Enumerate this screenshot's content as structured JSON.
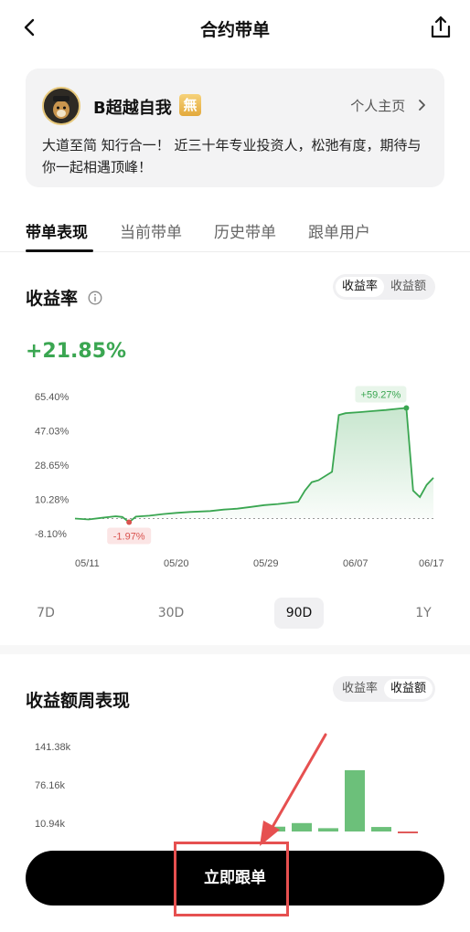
{
  "header": {
    "title": "合约带单",
    "back_icon": "chevron-left-icon",
    "share_icon": "share-icon"
  },
  "profile": {
    "name": "B超越自我",
    "badge": "無",
    "homepage_link": "个人主页",
    "bio": "大道至简 知行合一！ 近三十年专业投资人，松弛有度，期待与你一起相遇顶峰！"
  },
  "tabs": [
    {
      "label": "带单表现",
      "active": true
    },
    {
      "label": "当前带单",
      "active": false
    },
    {
      "label": "历史带单",
      "active": false
    },
    {
      "label": "跟单用户",
      "active": false
    }
  ],
  "returns": {
    "title": "收益率",
    "toggle": [
      "收益率",
      "收益额"
    ],
    "toggle_active": 0,
    "value": "+21.85%",
    "value_color": "#3aa651",
    "periods": [
      "7D",
      "30D",
      "90D",
      "1Y"
    ],
    "period_active": 2
  },
  "chart_data": [
    {
      "type": "area",
      "y_ticks": [
        "65.40%",
        "47.03%",
        "28.65%",
        "10.28%",
        "-8.10%"
      ],
      "x_ticks": [
        "05/11",
        "05/20",
        "05/29",
        "06/07",
        "06/17"
      ],
      "ylim": [
        -8.1,
        65.4
      ],
      "annotations": [
        {
          "label": "+59.27%",
          "color": "#3aa651"
        },
        {
          "label": "-1.97%",
          "color": "#d9534f"
        }
      ],
      "series": [
        {
          "color": "#3aa651",
          "points": [
            [
              0,
              0.0
            ],
            [
              2,
              -0.5
            ],
            [
              4,
              0.4
            ],
            [
              6,
              1.2
            ],
            [
              7,
              0.8
            ],
            [
              8,
              -1.97
            ],
            [
              9,
              1.0
            ],
            [
              11,
              1.5
            ],
            [
              13,
              2.4
            ],
            [
              15,
              3.0
            ],
            [
              17,
              3.5
            ],
            [
              20,
              4.0
            ],
            [
              22,
              4.8
            ],
            [
              24,
              5.3
            ],
            [
              26,
              6.2
            ],
            [
              28,
              7.2
            ],
            [
              30,
              7.8
            ],
            [
              33,
              9.0
            ],
            [
              34,
              15.0
            ],
            [
              35,
              19.5
            ],
            [
              36,
              20.5
            ],
            [
              38,
              25.0
            ],
            [
              39,
              55.5
            ],
            [
              40,
              56.5
            ],
            [
              42,
              57.0
            ],
            [
              44,
              57.6
            ],
            [
              46,
              58.2
            ],
            [
              48,
              59.0
            ],
            [
              49,
              59.27
            ],
            [
              50,
              15.0
            ],
            [
              51,
              11.5
            ],
            [
              52,
              18.0
            ],
            [
              53,
              21.85
            ]
          ]
        }
      ]
    },
    {
      "type": "bar",
      "title": "收益额周表现",
      "toggle": [
        "收益率",
        "收益额"
      ],
      "toggle_active": 1,
      "y_ticks": [
        "141.38k",
        "76.16k",
        "10.94k"
      ],
      "values": [
        8.0,
        14.0,
        5.5,
        102.0,
        7.5,
        -2.0
      ],
      "colors": [
        "#6cc07a",
        "#6cc07a",
        "#6cc07a",
        "#6cc07a",
        "#6cc07a",
        "#e05a5a"
      ]
    }
  ],
  "follow_button": {
    "label": "立即跟单"
  }
}
